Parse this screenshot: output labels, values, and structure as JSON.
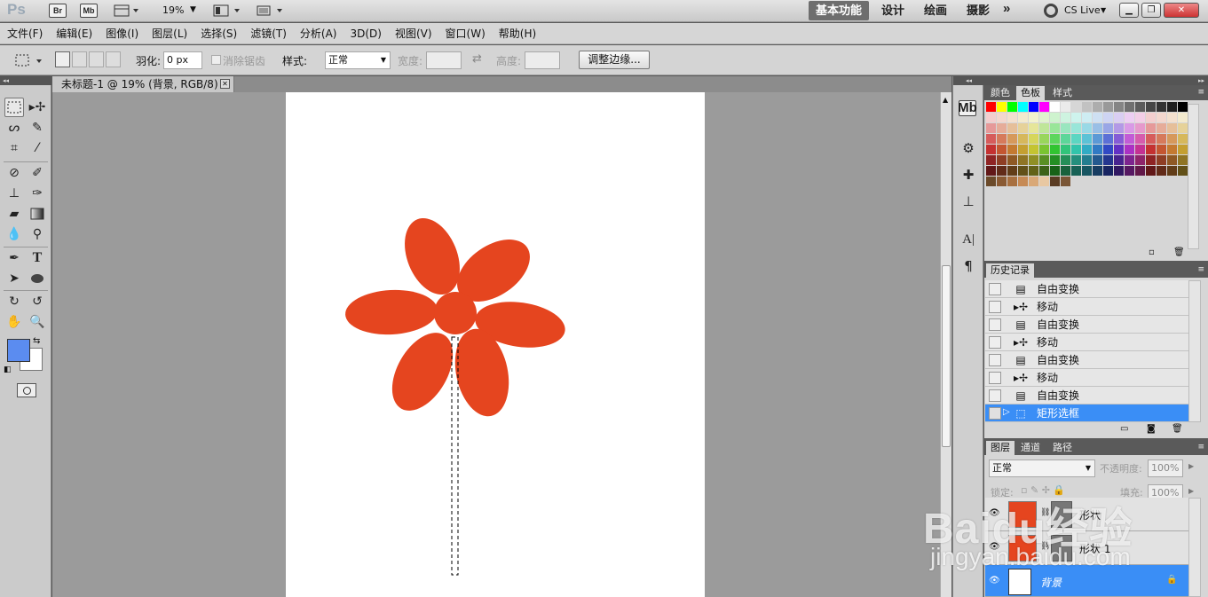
{
  "appbar": {
    "logo": "Ps",
    "bridge": "Br",
    "minibridge": "Mb",
    "zoom": "19%",
    "workspaces": [
      {
        "label": "基本功能",
        "active": true
      },
      {
        "label": "设计",
        "active": false
      },
      {
        "label": "绘画",
        "active": false
      },
      {
        "label": "摄影",
        "active": false
      }
    ],
    "more": "»",
    "cslive": "CS Live"
  },
  "menu": [
    "文件(F)",
    "编辑(E)",
    "图像(I)",
    "图层(L)",
    "选择(S)",
    "滤镜(T)",
    "分析(A)",
    "3D(D)",
    "视图(V)",
    "窗口(W)",
    "帮助(H)"
  ],
  "options": {
    "feather_label": "羽化:",
    "feather_value": "0 px",
    "antialias_label": "消除锯齿",
    "style_label": "样式:",
    "style_value": "正常",
    "width_label": "宽度:",
    "height_label": "高度:",
    "refine_button": "调整边缘..."
  },
  "document": {
    "tab_title": "未标题-1 @ 19% (背景, RGB/8) *",
    "shape_color": "#e5451f"
  },
  "colors": {
    "foreground": "#5b8cf0",
    "background": "#ffffff"
  },
  "swatches_panel": {
    "tabs": [
      {
        "label": "颜色",
        "active": false
      },
      {
        "label": "色板",
        "active": true
      },
      {
        "label": "样式",
        "active": false
      }
    ]
  },
  "history_panel": {
    "title": "历史记录",
    "items": [
      {
        "label": "自由变换",
        "icon": "transform-icon"
      },
      {
        "label": "移动",
        "icon": "move-icon"
      },
      {
        "label": "自由变换",
        "icon": "transform-icon"
      },
      {
        "label": "移动",
        "icon": "move-icon"
      },
      {
        "label": "自由变换",
        "icon": "transform-icon"
      },
      {
        "label": "移动",
        "icon": "move-icon"
      },
      {
        "label": "自由变换",
        "icon": "transform-icon"
      },
      {
        "label": "矩形选框",
        "icon": "marquee-icon",
        "selected": true
      }
    ]
  },
  "layers_panel": {
    "tabs": [
      {
        "label": "图层",
        "active": true
      },
      {
        "label": "通道",
        "active": false
      },
      {
        "label": "路径",
        "active": false
      }
    ],
    "blend_mode": "正常",
    "opacity_label": "不透明度:",
    "opacity_value": "100%",
    "lock_label": "锁定:",
    "fill_label": "填充:",
    "fill_value": "100%",
    "layers": [
      {
        "name": "形状",
        "color": "#e5451f",
        "selected": false
      },
      {
        "name": "形状 1",
        "color": "#e5451f",
        "selected": false
      },
      {
        "name": "背景",
        "color": "#ffffff",
        "selected": true
      }
    ]
  },
  "watermark": {
    "brand": "Baidu经验",
    "url": "jingyan.baidu.com"
  }
}
